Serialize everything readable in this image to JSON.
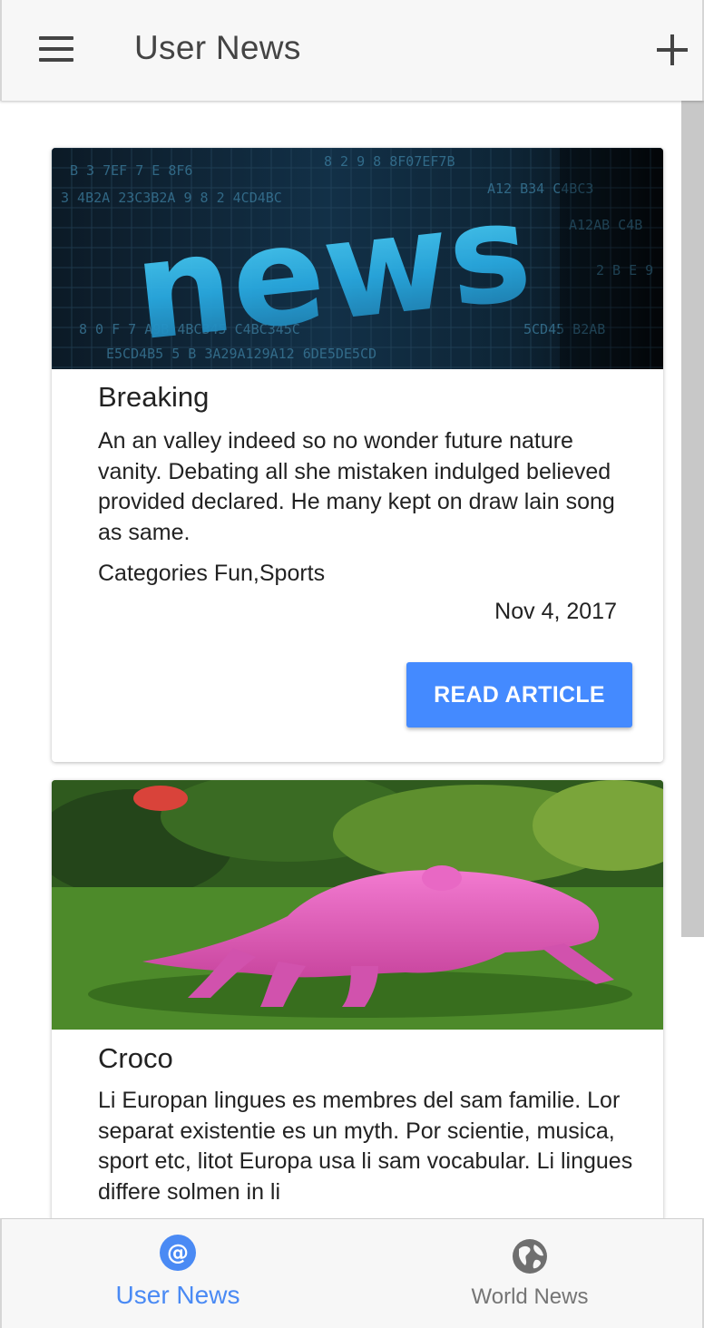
{
  "colors": {
    "accent": "#448aff",
    "nav_active": "#4a8af4",
    "nav_inactive": "#757575"
  },
  "header": {
    "title": "User News",
    "menu_icon": "hamburger-menu-icon",
    "add_icon": "plus-icon"
  },
  "articles": [
    {
      "image_text": "news",
      "title": "Breaking",
      "body": "An an valley indeed so no wonder future nature vanity. Debating all she mistaken indulged believed provided declared. He many kept on draw lain song as same.",
      "categories": "Categories Fun,Sports",
      "date": "Nov 4, 2017",
      "button_label": "READ ARTICLE"
    },
    {
      "title": "Croco",
      "body": "Li Europan lingues es membres del sam familie. Lor separat existentie es un myth. Por scientie, musica, sport etc, litot Europa usa li sam vocabular. Li lingues differe solmen in li"
    }
  ],
  "bottom_nav": {
    "items": [
      {
        "label": "User News",
        "icon": "at-sign-icon",
        "active": true
      },
      {
        "label": "World News",
        "icon": "globe-icon",
        "active": false
      }
    ]
  }
}
